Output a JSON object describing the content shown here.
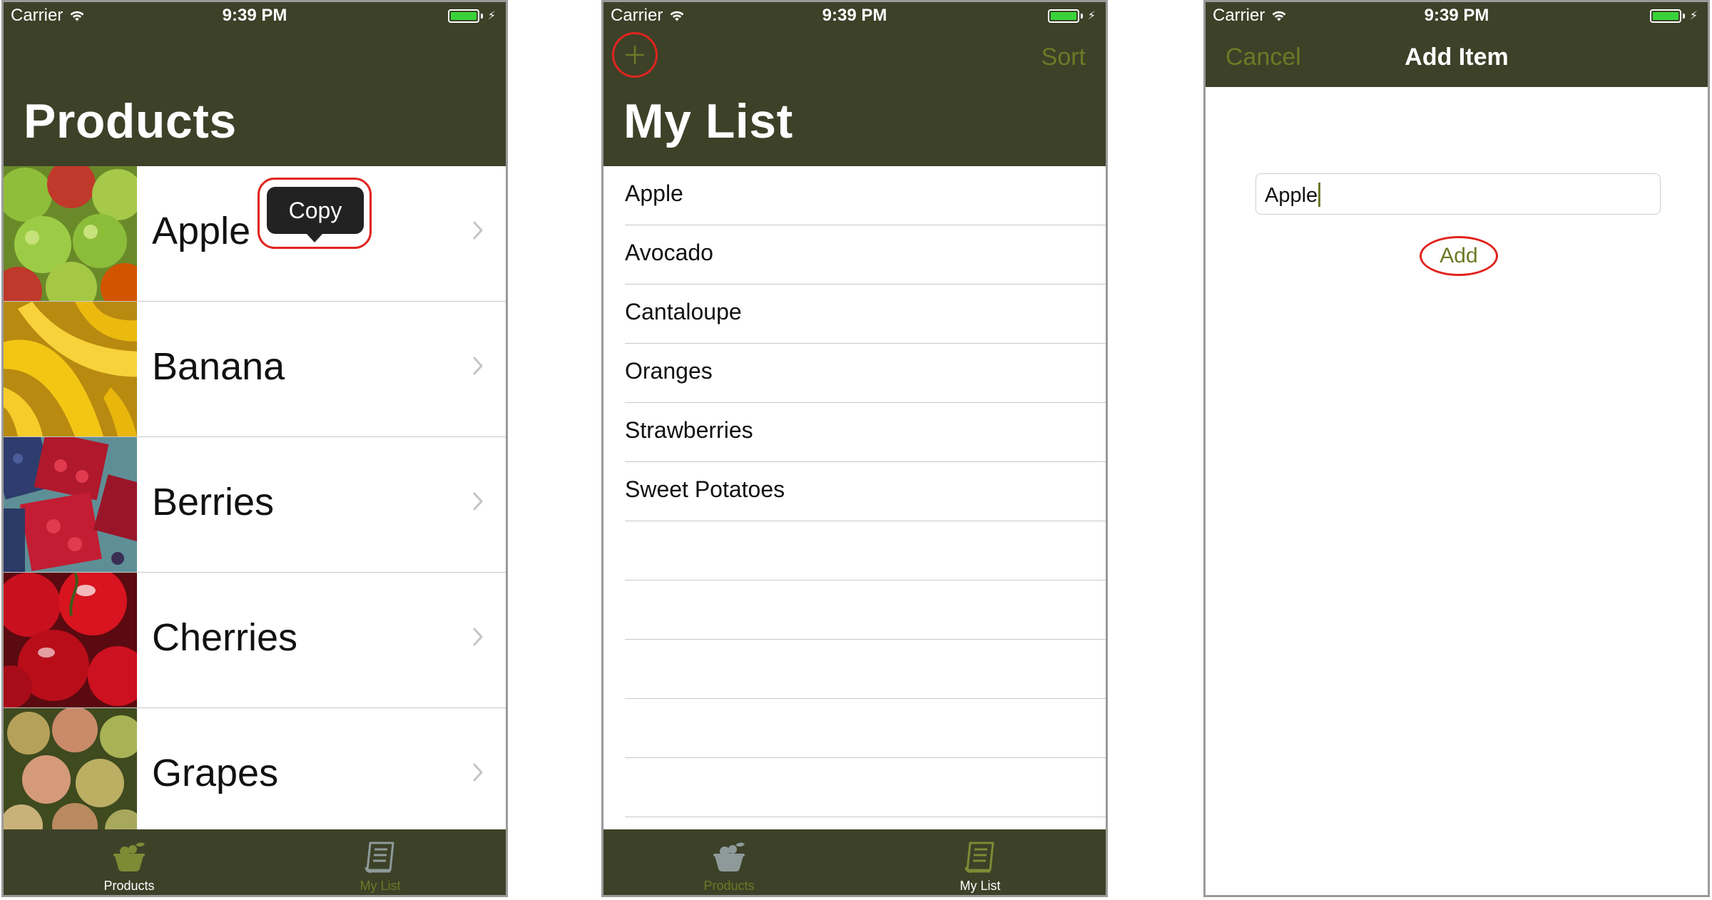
{
  "status_bar": {
    "carrier": "Carrier",
    "time": "9:39 PM"
  },
  "colors": {
    "nav_background": "#3c4128",
    "tint": "#6c7a26",
    "highlight_ring": "#e0241f",
    "battery": "#39d339"
  },
  "products_screen": {
    "title": "Products",
    "items": [
      {
        "name": "Apple",
        "image": "apples-photo"
      },
      {
        "name": "Banana",
        "image": "bananas-photo"
      },
      {
        "name": "Berries",
        "image": "berries-photo"
      },
      {
        "name": "Cherries",
        "image": "cherries-photo"
      },
      {
        "name": "Grapes",
        "image": "grapes-photo"
      }
    ],
    "copy_menu_label": "Copy",
    "tabs": [
      {
        "label": "Products",
        "icon": "fruit-basket-icon",
        "active": true
      },
      {
        "label": "My List",
        "icon": "list-icon",
        "active": false
      }
    ]
  },
  "my_list_screen": {
    "title": "My List",
    "sort_label": "Sort",
    "add_icon": "plus-icon",
    "items": [
      "Apple",
      "Avocado",
      "Cantaloupe",
      "Oranges",
      "Strawberries",
      "Sweet Potatoes"
    ],
    "tabs": [
      {
        "label": "Products",
        "icon": "fruit-basket-icon",
        "active": false
      },
      {
        "label": "My List",
        "icon": "list-icon",
        "active": true
      }
    ]
  },
  "add_item_screen": {
    "cancel_label": "Cancel",
    "title": "Add Item",
    "field_value": "Apple",
    "add_label": "Add"
  }
}
